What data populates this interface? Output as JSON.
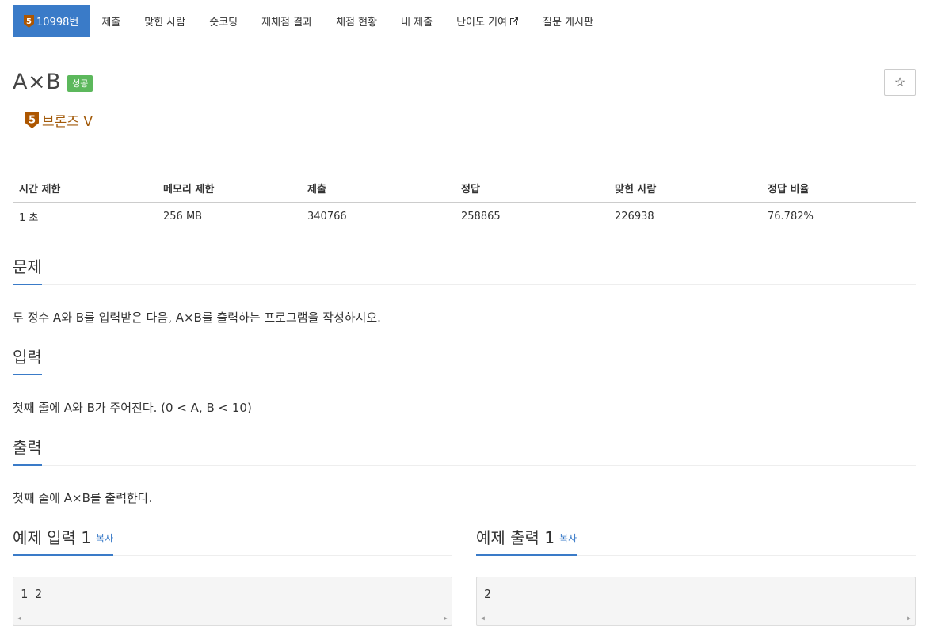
{
  "nav": {
    "problem_number": "10998번",
    "tier_digit": "5",
    "items": [
      "제출",
      "맞힌 사람",
      "숏코딩",
      "재채점 결과",
      "채점 현황",
      "내 제출",
      "난이도 기여",
      "질문 게시판"
    ]
  },
  "problem": {
    "title": "A×B",
    "result": "성공",
    "star": "☆",
    "tier": "브론즈 V",
    "tier_digit": "5"
  },
  "info_table": {
    "headers": [
      "시간 제한",
      "메모리 제한",
      "제출",
      "정답",
      "맞힌 사람",
      "정답 비율"
    ],
    "values": [
      "1 초",
      "256 MB",
      "340766",
      "258865",
      "226938",
      "76.782%"
    ]
  },
  "sections": {
    "description": {
      "title": "문제",
      "text": "두 정수 A와 B를 입력받은 다음, A×B를 출력하는 프로그램을 작성하시오."
    },
    "input": {
      "title": "입력",
      "text": "첫째 줄에 A와 B가 주어진다. (0 < A, B < 10)"
    },
    "output": {
      "title": "출력",
      "text": "첫째 줄에 A×B를 출력한다."
    }
  },
  "samples": {
    "input": {
      "title": "예제 입력 1",
      "copy": "복사",
      "content": "1 2"
    },
    "output": {
      "title": "예제 출력 1",
      "copy": "복사",
      "content": "2"
    }
  },
  "colors": {
    "nav_active": "#3a7bc8",
    "success": "#5cb85c",
    "bronze": "#a25a0a"
  }
}
